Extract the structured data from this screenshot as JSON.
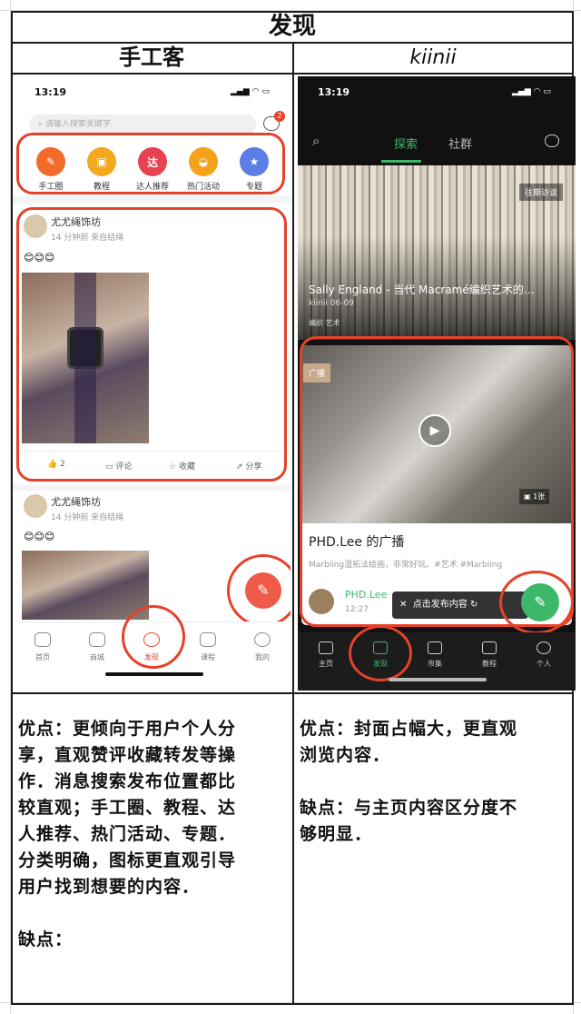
{
  "table": {
    "title": "发现",
    "col_left": "手工客",
    "col_right": "kiinii"
  },
  "left_app": {
    "status_time": "13:19",
    "search_placeholder": "请输入搜索关键字",
    "msg_badge": "2",
    "categories": [
      "手工圈",
      "教程",
      "达人推荐",
      "热门活动",
      "专题"
    ],
    "post": {
      "author": "尤尤绳饰坊",
      "meta": "14 分钟前   来自结绳",
      "emojis": "😊😊😊",
      "like_count": "2",
      "comment": "评论",
      "favorite": "收藏",
      "share": "分享"
    },
    "post2": {
      "author": "尤尤绳饰坊",
      "meta": "14 分钟前   来自结绳",
      "emojis": "😊😊😊"
    },
    "tabs": [
      "首页",
      "商城",
      "发现",
      "课程",
      "我的"
    ]
  },
  "right_app": {
    "status_time": "13:19",
    "tab_explore": "探索",
    "tab_community": "社群",
    "banner_badge": "往期访谈",
    "banner_title": "Sally England - 当代 Macramé编织艺术的…",
    "banner_meta": "kiinii   06-09",
    "banner_tags": "编织   艺术",
    "broadcast_badge": "广播",
    "photo_count": "1张",
    "card_title": "PHD.Lee 的广播",
    "card_desc": "Marbling湿拓法绘画，非常好玩。#艺术 #Marbling",
    "card_user": "PHD.Lee",
    "card_time": "12:27",
    "toast": "点击发布内容",
    "tabs": [
      "主页",
      "发现",
      "市集",
      "教程",
      "个人"
    ]
  },
  "notes_left": {
    "pros": [
      "优点：更倾向于用户个人分",
      "享，直观赞评收藏转发等操",
      "作．消息搜索发布位置都比",
      "较直观；手工圈、教程、达",
      "人推荐、热门活动、专题．",
      "分类明确，图标更直观引导",
      "用户找到想要的内容．"
    ],
    "cons": "缺点："
  },
  "notes_right": {
    "pros": [
      "优点：封面占幅大，更直观",
      "浏览内容．"
    ],
    "cons": [
      "缺点：与主页内容区分度不",
      "够明显．"
    ]
  },
  "colors": {
    "accent_red": "#e5422a",
    "kiinii_green": "#3db86a"
  }
}
